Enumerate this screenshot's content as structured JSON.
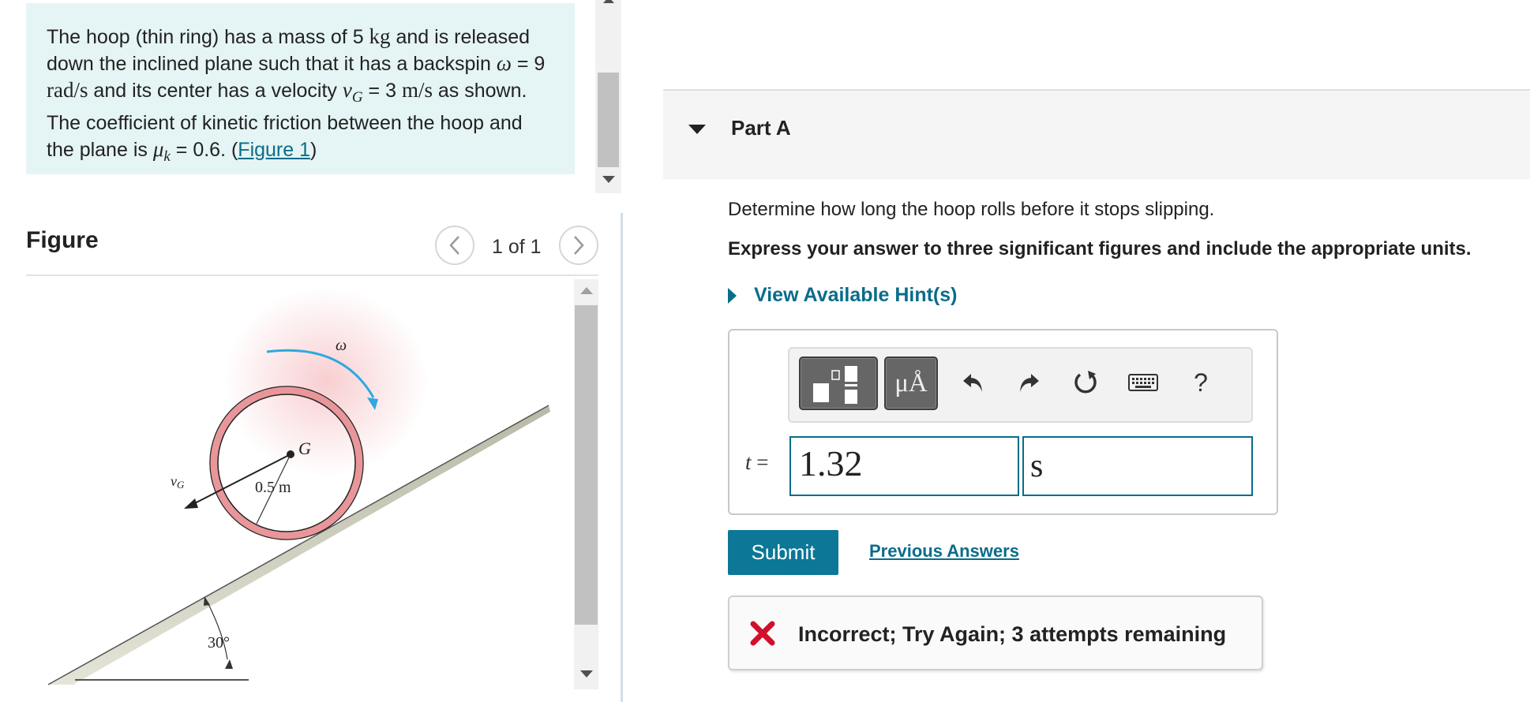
{
  "problem": {
    "text_1": "The hoop (thin ring) has a mass of 5 ",
    "mass_unit": "kg",
    "text_2": " and is released down the inclined plane such that it has a backspin ",
    "omega_symbol": "ω",
    "text_3": " = 9 ",
    "omega_unit": "rad/s",
    "text_4": " and its center has a velocity ",
    "vg_symbol": "v",
    "vg_sub": "G",
    "text_5": " = 3 ",
    "vg_unit": "m/s",
    "text_6": " as shown. The coefficient of kinetic friction between the hoop and the plane is ",
    "mu_symbol": "μ",
    "mu_sub": "k",
    "text_7": " = 0.6. (",
    "figure_link": "Figure 1",
    "text_8": ")"
  },
  "figure": {
    "title": "Figure",
    "pager": "1 of 1",
    "prev_icon": "chevron-left-icon",
    "next_icon": "chevron-right-icon",
    "labels": {
      "omega": "ω",
      "g": "G",
      "vg": "v",
      "vg_sub": "G",
      "radius": "0.5 m",
      "angle": "30°"
    },
    "colors": {
      "hoop": "#e8969a",
      "hoop_edge": "#222222",
      "glow": "#f7c9cc",
      "arrow": "#2fa8e0",
      "plane": "#cfcfbf"
    }
  },
  "part": {
    "title": "Part A",
    "question": "Determine how long the hoop rolls before it stops slipping.",
    "instruction": "Express your answer to three significant figures and include the appropriate units.",
    "hints_label": "View Available Hint(s)"
  },
  "toolbar": {
    "units_label": "μÅ",
    "help_label": "?",
    "icons": [
      "templates-icon",
      "units-icon",
      "undo-icon",
      "redo-icon",
      "reset-icon",
      "keyboard-icon",
      "help-icon"
    ]
  },
  "answer": {
    "variable": "t",
    "equals": " =",
    "value": "1.32",
    "unit": "s"
  },
  "actions": {
    "submit": "Submit",
    "previous_answers": "Previous Answers"
  },
  "feedback": {
    "text": "Incorrect; Try Again; 3 attempts remaining",
    "icon": "x-mark-icon",
    "color": "#d0112b"
  },
  "colors": {
    "accent": "#0c7796",
    "link": "#0a6c8a",
    "problem_bg": "#e5f4f4"
  }
}
